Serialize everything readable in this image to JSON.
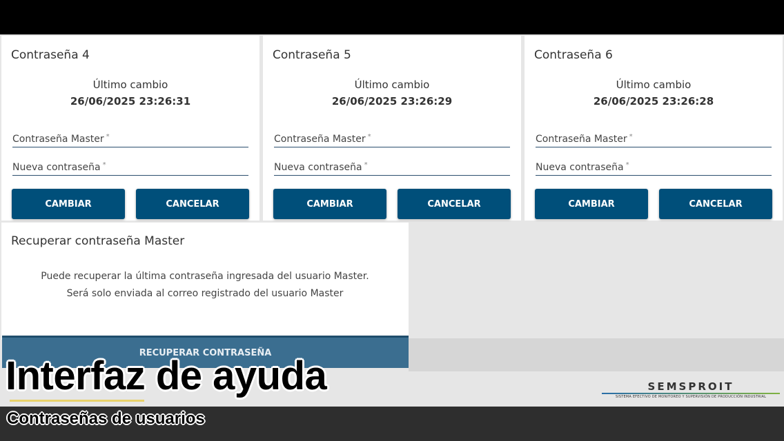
{
  "cards": [
    {
      "title": "Contraseña 4",
      "last_label": "Último cambio",
      "last_date": "26/06/2025 23:26:31",
      "master_label": "Contraseña Master",
      "new_label": "Nueva contraseña",
      "required_mark": "*",
      "change_label": "CAMBIAR",
      "cancel_label": "CANCELAR"
    },
    {
      "title": "Contraseña 5",
      "last_label": "Último cambio",
      "last_date": "26/06/2025 23:26:29",
      "master_label": "Contraseña Master",
      "new_label": "Nueva contraseña",
      "required_mark": "*",
      "change_label": "CAMBIAR",
      "cancel_label": "CANCELAR"
    },
    {
      "title": "Contraseña 6",
      "last_label": "Último cambio",
      "last_date": "26/06/2025 23:26:28",
      "master_label": "Contraseña Master",
      "new_label": "Nueva contraseña",
      "required_mark": "*",
      "change_label": "CAMBIAR",
      "cancel_label": "CANCELAR"
    }
  ],
  "recover": {
    "title": "Recuperar contraseña Master",
    "line1": "Puede recuperar la última contraseña ingresada del usuario Master.",
    "line2": "Será solo enviada al correo registrado del usuario Master",
    "button_label": "RECUPERAR CONTRASEÑA"
  },
  "overlay": {
    "title": "Interfaz de ayuda",
    "subtitle": "Contraseñas de usuarios"
  },
  "logo": {
    "name": "SEMSPROIT",
    "tagline": "SISTEMA EFECTIVO DE MONITOREO Y SUPERVISIÓN DE PRODUCCIÓN INDUSTRIAL"
  },
  "colors": {
    "button": "#004f7a",
    "recover_button": "#3b6e90",
    "field_underline": "#2a4d6e"
  }
}
